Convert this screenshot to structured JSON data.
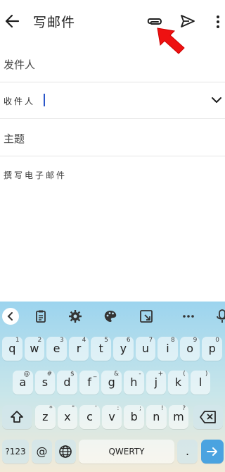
{
  "appbar": {
    "title": "写邮件",
    "back_icon": "arrow-left-icon",
    "attach_icon": "paperclip-icon",
    "send_icon": "send-icon",
    "more_icon": "more-vertical-icon"
  },
  "annotation": {
    "icon": "red-arrow-icon",
    "color": "#ee1111"
  },
  "form": {
    "from_label": "发件人",
    "to_label": "收件人",
    "subject_label": "主题",
    "body_placeholder": "撰写电子邮件"
  },
  "keyboard": {
    "toolbar_icons": [
      "collapse-chevron-icon",
      "clipboard-icon",
      "gear-icon",
      "palette-icon",
      "resize-icon",
      "more-horizontal-icon",
      "microphone-icon"
    ],
    "row1": [
      {
        "k": "q",
        "s": "1"
      },
      {
        "k": "w",
        "s": "2"
      },
      {
        "k": "e",
        "s": "3"
      },
      {
        "k": "r",
        "s": "4"
      },
      {
        "k": "t",
        "s": "5"
      },
      {
        "k": "y",
        "s": "6"
      },
      {
        "k": "u",
        "s": "7"
      },
      {
        "k": "i",
        "s": "8"
      },
      {
        "k": "o",
        "s": "9"
      },
      {
        "k": "p",
        "s": "0"
      }
    ],
    "row2": [
      {
        "k": "a",
        "s": "@"
      },
      {
        "k": "s",
        "s": "#"
      },
      {
        "k": "d",
        "s": "$"
      },
      {
        "k": "f",
        "s": "_"
      },
      {
        "k": "g",
        "s": "&"
      },
      {
        "k": "h",
        "s": "-"
      },
      {
        "k": "j",
        "s": "+"
      },
      {
        "k": "k",
        "s": "("
      },
      {
        "k": "l",
        "s": ")"
      }
    ],
    "row3": [
      {
        "k": "z",
        "s": "*"
      },
      {
        "k": "x",
        "s": "\""
      },
      {
        "k": "c",
        "s": "'"
      },
      {
        "k": "v",
        "s": ":"
      },
      {
        "k": "b",
        "s": ";"
      },
      {
        "k": "n",
        "s": "!"
      },
      {
        "k": "m",
        "s": "?"
      }
    ],
    "shift_icon": "shift-icon",
    "backspace_icon": "backspace-icon",
    "symbols_label": "?123",
    "at_label": "@",
    "globe_icon": "globe-icon",
    "space_label": "QWERTY",
    "period_label": ".",
    "enter_icon": "arrow-right-icon"
  }
}
